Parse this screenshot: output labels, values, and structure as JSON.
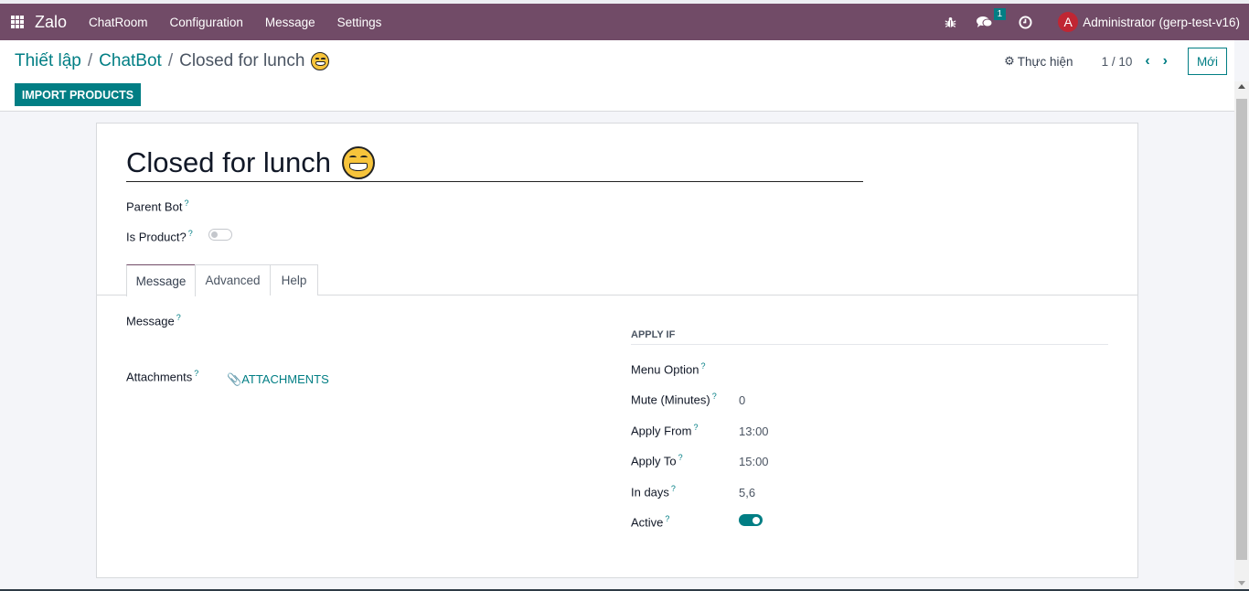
{
  "navbar": {
    "brand": "Zalo",
    "menu": [
      "ChatRoom",
      "Configuration",
      "Message",
      "Settings"
    ],
    "icons": [
      "bug-icon",
      "chat-icon",
      "clock-icon"
    ],
    "chat_badge": "1",
    "user_initial": "A",
    "user_name": "Administrator (gerp-test-v16)",
    "color": "#714b67"
  },
  "breadcrumb": {
    "items": [
      "Thiết lập",
      "ChatBot"
    ],
    "separator": "/",
    "current": "Closed for lunch"
  },
  "actions": {
    "action_label": "Thực hiện",
    "pager": "1 / 10",
    "new_label": "Mới"
  },
  "import_button": "IMPORT PRODUCTS",
  "record": {
    "title": "Closed for lunch",
    "emoji": "grinning-face",
    "parent_bot_label": "Parent Bot",
    "is_product_label": "Is Product?",
    "is_product": false
  },
  "tabs": [
    "Message",
    "Advanced",
    "Help"
  ],
  "active_tab": "Message",
  "message_tab": {
    "message_label": "Message",
    "attachments_label": "Attachments",
    "attachments_button": "ATTACHMENTS",
    "apply_if": {
      "title": "APPLY IF",
      "menu_option_label": "Menu Option",
      "mute_label": "Mute (Minutes)",
      "mute_value": "0",
      "apply_from_label": "Apply From",
      "apply_from_value": "13:00",
      "apply_to_label": "Apply To",
      "apply_to_value": "15:00",
      "in_days_label": "In days",
      "in_days_value": "5,6",
      "active_label": "Active",
      "active": true
    }
  },
  "help_mark": "?",
  "accent_color": "#017e84"
}
